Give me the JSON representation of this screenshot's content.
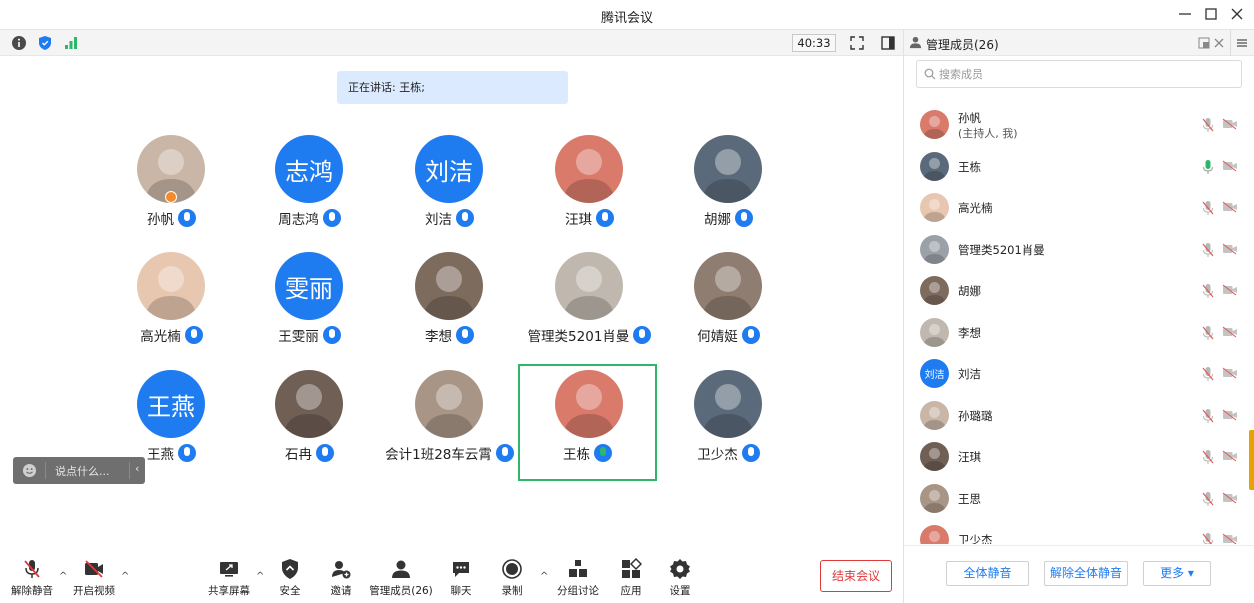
{
  "window": {
    "title": "腾讯会议"
  },
  "statusbar": {
    "timer": "40:33",
    "icons": [
      "info-icon",
      "shield-icon",
      "signal-icon",
      "fullscreen-icon",
      "layout-icon"
    ]
  },
  "main": {
    "speaking": "正在讲话: 王栋;",
    "chat_placeholder": "说点什么...",
    "participants": [
      {
        "name": "孙帆",
        "avatar": "photo",
        "mic": "on",
        "host": true
      },
      {
        "name": "周志鸿",
        "avatar": "text",
        "avatar_text": "志鸿",
        "mic": "on"
      },
      {
        "name": "刘洁",
        "avatar": "text",
        "avatar_text": "刘洁",
        "mic": "on"
      },
      {
        "name": "汪琪",
        "avatar": "photo",
        "mic": "on"
      },
      {
        "name": "胡娜",
        "avatar": "photo",
        "mic": "on"
      },
      {
        "name": "高光楠",
        "avatar": "photo",
        "mic": "on"
      },
      {
        "name": "王雯丽",
        "avatar": "text",
        "avatar_text": "雯丽",
        "mic": "on"
      },
      {
        "name": "李想",
        "avatar": "photo",
        "mic": "on"
      },
      {
        "name": "管理类5201肖曼",
        "avatar": "photo",
        "mic": "on"
      },
      {
        "name": "何婧娗",
        "avatar": "photo",
        "mic": "on"
      },
      {
        "name": "王燕",
        "avatar": "text",
        "avatar_text": "王燕",
        "mic": "on"
      },
      {
        "name": "石冉",
        "avatar": "photo",
        "mic": "on"
      },
      {
        "name": "会计1班28车云霄",
        "avatar": "photo",
        "mic": "on"
      },
      {
        "name": "王栋",
        "avatar": "photo",
        "mic": "speaking",
        "active": true
      },
      {
        "name": "卫少杰",
        "avatar": "photo",
        "mic": "on"
      }
    ]
  },
  "toolbar": {
    "unmute": "解除静音",
    "start_video": "开启视频",
    "share_screen": "共享屏幕",
    "security": "安全",
    "invite": "邀请",
    "manage_members": "管理成员(26)",
    "chat": "聊天",
    "record": "录制",
    "breakout": "分组讨论",
    "apps": "应用",
    "settings": "设置",
    "end_meeting": "结束会议"
  },
  "panel": {
    "title": "管理成员(26)",
    "search_placeholder": "搜索成员",
    "members": [
      {
        "name": "孙帆",
        "sub": "(主持人, 我)",
        "avatar": "photo",
        "mic": "muted"
      },
      {
        "name": "王栋",
        "avatar": "photo",
        "mic": "speaking"
      },
      {
        "name": "高光楠",
        "avatar": "photo",
        "mic": "muted"
      },
      {
        "name": "管理类5201肖曼",
        "avatar": "photo",
        "mic": "muted"
      },
      {
        "name": "胡娜",
        "avatar": "photo",
        "mic": "muted"
      },
      {
        "name": "李想",
        "avatar": "photo",
        "mic": "muted"
      },
      {
        "name": "刘洁",
        "avatar": "text",
        "avatar_text": "刘洁",
        "mic": "muted"
      },
      {
        "name": "孙璐璐",
        "avatar": "photo",
        "mic": "muted"
      },
      {
        "name": "汪琪",
        "avatar": "photo",
        "mic": "muted"
      },
      {
        "name": "王思",
        "avatar": "photo",
        "mic": "muted"
      },
      {
        "name": "卫少杰",
        "avatar": "photo",
        "mic": "muted"
      }
    ],
    "mute_all": "全体静音",
    "unmute_all": "解除全体静音",
    "more": "更多"
  },
  "colors": {
    "accent": "#1f7cf0",
    "speaking": "#2eb66a",
    "danger": "#e03a3a"
  }
}
